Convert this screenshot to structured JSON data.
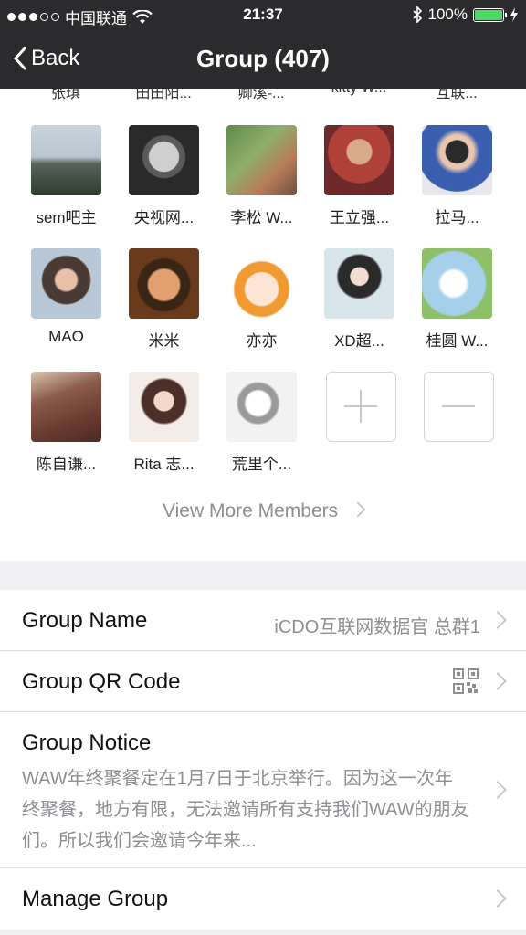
{
  "status_bar": {
    "carrier": "中国联通",
    "time": "21:37",
    "battery": "100%",
    "battery_level": 1.0
  },
  "nav": {
    "back_label": "Back",
    "title": "Group (407)"
  },
  "members_partial_row": [
    "张琪",
    "田田阳...",
    "卿溪-...",
    "kitty W...",
    "互联..."
  ],
  "members": [
    {
      "name": "sem吧主"
    },
    {
      "name": "央视网..."
    },
    {
      "name": "李松 W..."
    },
    {
      "name": "王立强..."
    },
    {
      "name": "拉马..."
    },
    {
      "name": "MAO"
    },
    {
      "name": "米米"
    },
    {
      "name": "亦亦"
    },
    {
      "name": "XD超..."
    },
    {
      "name": "桂圆 W..."
    },
    {
      "name": "陈自谦..."
    },
    {
      "name": "Rita 志..."
    },
    {
      "name": "荒里个..."
    }
  ],
  "view_more": "View More Members",
  "settings": {
    "group_name_label": "Group Name",
    "group_name_value": "iCDO互联网数据官 总群1",
    "qr_label": "Group QR Code",
    "notice_label": "Group Notice",
    "notice_text": "WAW年终聚餐定在1月7日于北京举行。因为这一次年终聚餐，地方有限，无法邀请所有支持我们WAW的朋友们。所以我们会邀请今年来...",
    "manage_label": "Manage Group"
  }
}
